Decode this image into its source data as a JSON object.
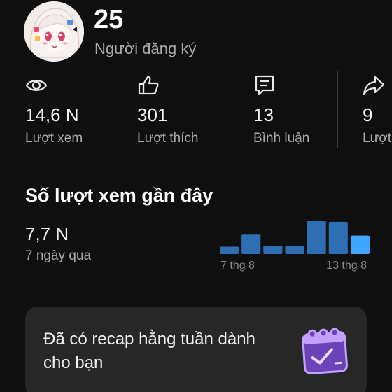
{
  "channel": {
    "subscriber_count": "25",
    "subscriber_label": "Người đăng ký",
    "avatar_icon": "anime-avatar-icon"
  },
  "stats": [
    {
      "icon": "eye-icon",
      "value": "14,6 N",
      "label": "Lượt xem"
    },
    {
      "icon": "thumbs-up-icon",
      "value": "301",
      "label": "Lượt thích"
    },
    {
      "icon": "comment-icon",
      "value": "13",
      "label": "Bình luận"
    },
    {
      "icon": "share-icon",
      "value": "9",
      "label": "Lượt chia sẻ"
    }
  ],
  "recent_views": {
    "title": "Số lượt xem gần đây",
    "value": "7,7 N",
    "period": "7 ngày qua"
  },
  "chart_data": {
    "type": "bar",
    "categories": [
      "",
      "7 thg 8",
      "",
      "",
      "",
      "",
      "13 thg 8"
    ],
    "x_tick_labels": [
      "7 thg 8",
      "13 thg 8"
    ],
    "values": [
      0.22,
      0.6,
      0.25,
      0.25,
      1.0,
      0.96,
      0.55
    ],
    "highlight_last": true,
    "colors": {
      "bar": "#2e6fb3",
      "last_bar": "#3ea6ff"
    }
  },
  "recap": {
    "text": "Đã có recap hằng tuần dành cho bạn",
    "icon": "weekly-calendar-icon",
    "icon_color": "#b48cf2"
  }
}
